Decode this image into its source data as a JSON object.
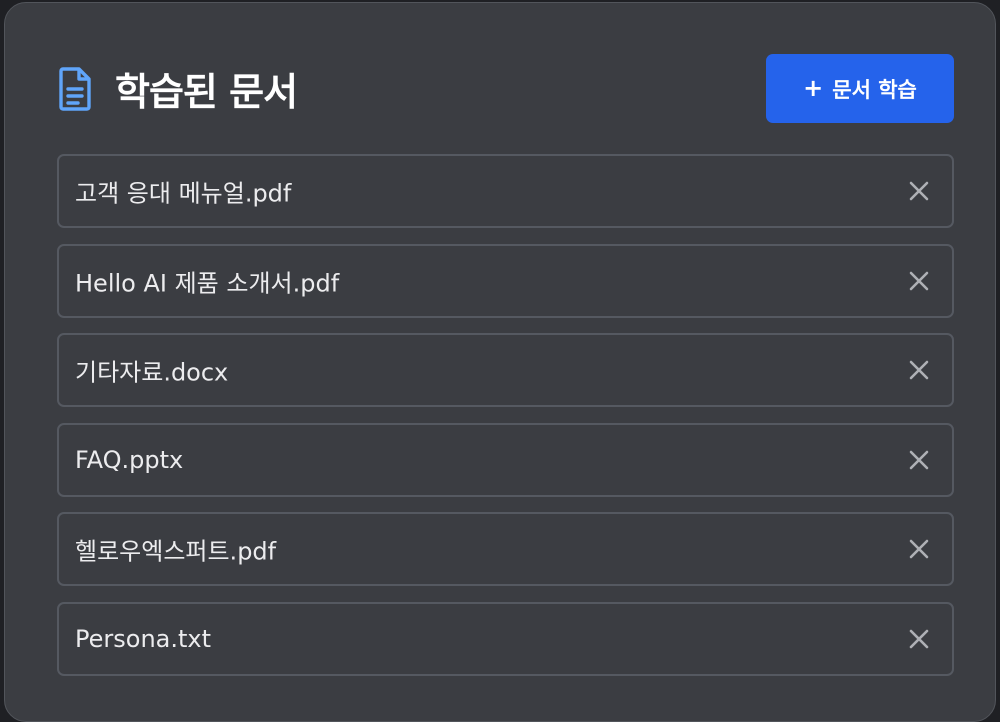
{
  "header": {
    "title": "학습된 문서",
    "icon": "document-icon",
    "learn_button": {
      "plus": "+",
      "label": "문서 학습"
    }
  },
  "documents": [
    {
      "name": "고객 응대 메뉴얼.pdf",
      "remove_icon": "close-icon"
    },
    {
      "name": "Hello AI 제품 소개서.pdf",
      "remove_icon": "close-icon"
    },
    {
      "name": "기타자료.docx",
      "remove_icon": "close-icon"
    },
    {
      "name": "FAQ.pptx",
      "remove_icon": "close-icon"
    },
    {
      "name": "헬로우엑스퍼트.pdf",
      "remove_icon": "close-icon"
    },
    {
      "name": "Persona.txt",
      "remove_icon": "close-icon"
    }
  ],
  "colors": {
    "background": "#1f2024",
    "panel": "#3b3d42",
    "border": "#555961",
    "accent": "#2563eb",
    "icon": "#60a5fa",
    "close_icon": "#aeb0b5"
  }
}
